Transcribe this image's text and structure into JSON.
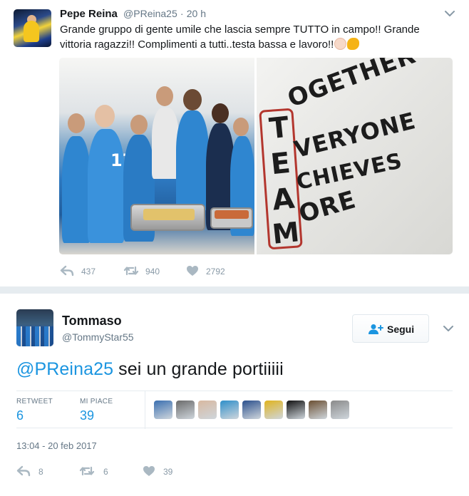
{
  "top_tweet": {
    "name": "Pepe Reina",
    "handle": "@PReina25",
    "separator": "·",
    "time": "20 h",
    "text": "Grande gruppo di gente umile che lascia sempre TUTTO in campo!! Grande vittoria ragazzi!! Complimenti a tutti..testa bassa e lavoro!!",
    "emojis": [
      "clapping-hands",
      "flexed-biceps"
    ],
    "team_image_words": [
      "OGETHER",
      "VERYONE",
      "CHIEVES",
      "ORE"
    ],
    "team_image_initials": [
      "T",
      "E",
      "A",
      "M"
    ],
    "jersey_number": "17",
    "actions": {
      "reply_count": "437",
      "retweet_count": "940",
      "like_count": "2792"
    }
  },
  "main_tweet": {
    "name": "Tommaso",
    "handle": "@TommyStar55",
    "follow_label": "Segui",
    "text_mention": "@PReina25",
    "text_rest": " sei un grande portiiiii",
    "stats": {
      "retweet_label": "RETWEET",
      "retweet_value": "6",
      "like_label": "MI PIACE",
      "like_value": "39"
    },
    "likers": [
      {
        "name": "liker-1",
        "color": "#3a6fb0"
      },
      {
        "name": "liker-2",
        "color": "#6b6b6b"
      },
      {
        "name": "liker-3",
        "color": "#d8b8a0"
      },
      {
        "name": "liker-4",
        "color": "#2f8fc9"
      },
      {
        "name": "liker-5",
        "color": "#2a4f8c"
      },
      {
        "name": "liker-6",
        "color": "#e0b31e"
      },
      {
        "name": "liker-7",
        "color": "#111111"
      },
      {
        "name": "liker-8",
        "color": "#6b4f32"
      },
      {
        "name": "liker-9",
        "color": "#8a8a8a"
      }
    ],
    "timestamp": "13:04 - 20 feb 2017",
    "actions": {
      "reply_count": "8",
      "retweet_count": "6",
      "like_count": "39"
    }
  },
  "colors": {
    "link": "#1b95e0",
    "muted": "#657786",
    "icon": "#8899a6",
    "separator": "#e6ecf0"
  }
}
